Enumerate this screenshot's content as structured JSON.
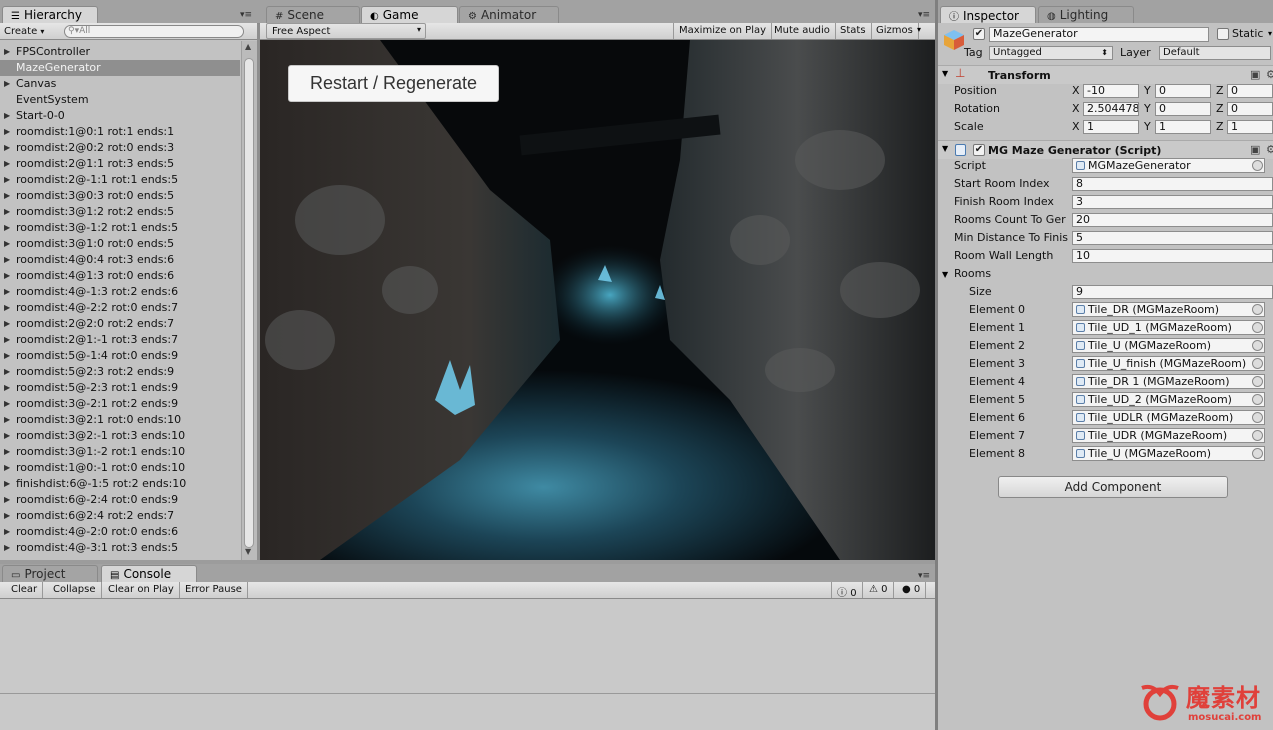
{
  "hierarchy": {
    "tab": "Hierarchy",
    "create_label": "Create",
    "search_placeholder": "All",
    "items": [
      {
        "label": "FPSController",
        "fold": true
      },
      {
        "label": "MazeGenerator",
        "fold": false,
        "selected": true
      },
      {
        "label": "Canvas",
        "fold": true
      },
      {
        "label": "EventSystem",
        "fold": false
      },
      {
        "label": "Start-0-0",
        "fold": true
      },
      {
        "label": "roomdist:1@0:1 rot:1 ends:1",
        "fold": true
      },
      {
        "label": "roomdist:2@0:2 rot:0 ends:3",
        "fold": true
      },
      {
        "label": "roomdist:2@1:1 rot:3 ends:5",
        "fold": true
      },
      {
        "label": "roomdist:2@-1:1 rot:1 ends:5",
        "fold": true
      },
      {
        "label": "roomdist:3@0:3 rot:0 ends:5",
        "fold": true
      },
      {
        "label": "roomdist:3@1:2 rot:2 ends:5",
        "fold": true
      },
      {
        "label": "roomdist:3@-1:2 rot:1 ends:5",
        "fold": true
      },
      {
        "label": "roomdist:3@1:0 rot:0 ends:5",
        "fold": true
      },
      {
        "label": "roomdist:4@0:4 rot:3 ends:6",
        "fold": true
      },
      {
        "label": "roomdist:4@1:3 rot:0 ends:6",
        "fold": true
      },
      {
        "label": "roomdist:4@-1:3 rot:2 ends:6",
        "fold": true
      },
      {
        "label": "roomdist:4@-2:2 rot:0 ends:7",
        "fold": true
      },
      {
        "label": "roomdist:2@2:0 rot:2 ends:7",
        "fold": true
      },
      {
        "label": "roomdist:2@1:-1 rot:3 ends:7",
        "fold": true
      },
      {
        "label": "roomdist:5@-1:4 rot:0 ends:9",
        "fold": true
      },
      {
        "label": "roomdist:5@2:3 rot:2 ends:9",
        "fold": true
      },
      {
        "label": "roomdist:5@-2:3 rot:1 ends:9",
        "fold": true
      },
      {
        "label": "roomdist:3@-2:1 rot:2 ends:9",
        "fold": true
      },
      {
        "label": "roomdist:3@2:1 rot:0 ends:10",
        "fold": true
      },
      {
        "label": "roomdist:3@2:-1 rot:3 ends:10",
        "fold": true
      },
      {
        "label": "roomdist:3@1:-2 rot:1 ends:10",
        "fold": true
      },
      {
        "label": "roomdist:1@0:-1 rot:0 ends:10",
        "fold": true
      },
      {
        "label": "finishdist:6@-1:5 rot:2 ends:10",
        "fold": true
      },
      {
        "label": "roomdist:6@-2:4 rot:0 ends:9",
        "fold": true
      },
      {
        "label": "roomdist:6@2:4 rot:2 ends:7",
        "fold": true
      },
      {
        "label": "roomdist:4@-2:0 rot:0 ends:6",
        "fold": true
      },
      {
        "label": "roomdist:4@-3:1 rot:3 ends:5",
        "fold": true
      }
    ]
  },
  "center_tabs": {
    "scene": "Scene",
    "game": "Game",
    "animator": "Animator"
  },
  "game_toolbar": {
    "aspect": "Free Aspect",
    "maximize": "Maximize on Play",
    "mute": "Mute audio",
    "stats": "Stats",
    "gizmos": "Gizmos"
  },
  "game_view": {
    "restart_button": "Restart / Regenerate"
  },
  "bottom_tabs": {
    "project": "Project",
    "console": "Console"
  },
  "console_toolbar": {
    "clear": "Clear",
    "collapse": "Collapse",
    "clear_on_play": "Clear on Play",
    "error_pause": "Error Pause",
    "log_count": "0",
    "warn_count": "0",
    "error_count": "0"
  },
  "inspector": {
    "tab": "Inspector",
    "lighting_tab": "Lighting",
    "object_name": "MazeGenerator",
    "static_label": "Static",
    "tag_label": "Tag",
    "tag_value": "Untagged",
    "layer_label": "Layer",
    "layer_value": "Default",
    "transform": {
      "title": "Transform",
      "position_label": "Position",
      "rotation_label": "Rotation",
      "scale_label": "Scale",
      "position": {
        "x": "-10",
        "y": "0",
        "z": "0"
      },
      "rotation": {
        "x": "2.504478",
        "y": "0",
        "z": "0"
      },
      "scale": {
        "x": "1",
        "y": "1",
        "z": "1"
      }
    },
    "script_component": {
      "title": "MG Maze Generator (Script)",
      "script_label": "Script",
      "script_value": "MGMazeGenerator",
      "fields": [
        {
          "label": "Start Room Index",
          "value": "8"
        },
        {
          "label": "Finish Room Index",
          "value": "3"
        },
        {
          "label": "Rooms Count To Ger",
          "value": "20"
        },
        {
          "label": "Min Distance To Finis",
          "value": "5"
        },
        {
          "label": "Room Wall Length",
          "value": "10"
        }
      ],
      "rooms_label": "Rooms",
      "size_label": "Size",
      "size_value": "9",
      "elements": [
        {
          "label": "Element 0",
          "value": "Tile_DR (MGMazeRoom)"
        },
        {
          "label": "Element 1",
          "value": "Tile_UD_1 (MGMazeRoom)"
        },
        {
          "label": "Element 2",
          "value": "Tile_U (MGMazeRoom)"
        },
        {
          "label": "Element 3",
          "value": "Tile_U_finish (MGMazeRoom)"
        },
        {
          "label": "Element 4",
          "value": "Tile_DR 1 (MGMazeRoom)"
        },
        {
          "label": "Element 5",
          "value": "Tile_UD_2 (MGMazeRoom)"
        },
        {
          "label": "Element 6",
          "value": "Tile_UDLR (MGMazeRoom)"
        },
        {
          "label": "Element 7",
          "value": "Tile_UDR (MGMazeRoom)"
        },
        {
          "label": "Element 8",
          "value": "Tile_U (MGMazeRoom)"
        }
      ]
    },
    "add_component": "Add Component"
  },
  "watermark": {
    "brand": "魔素材",
    "url": "mosucai.com"
  }
}
